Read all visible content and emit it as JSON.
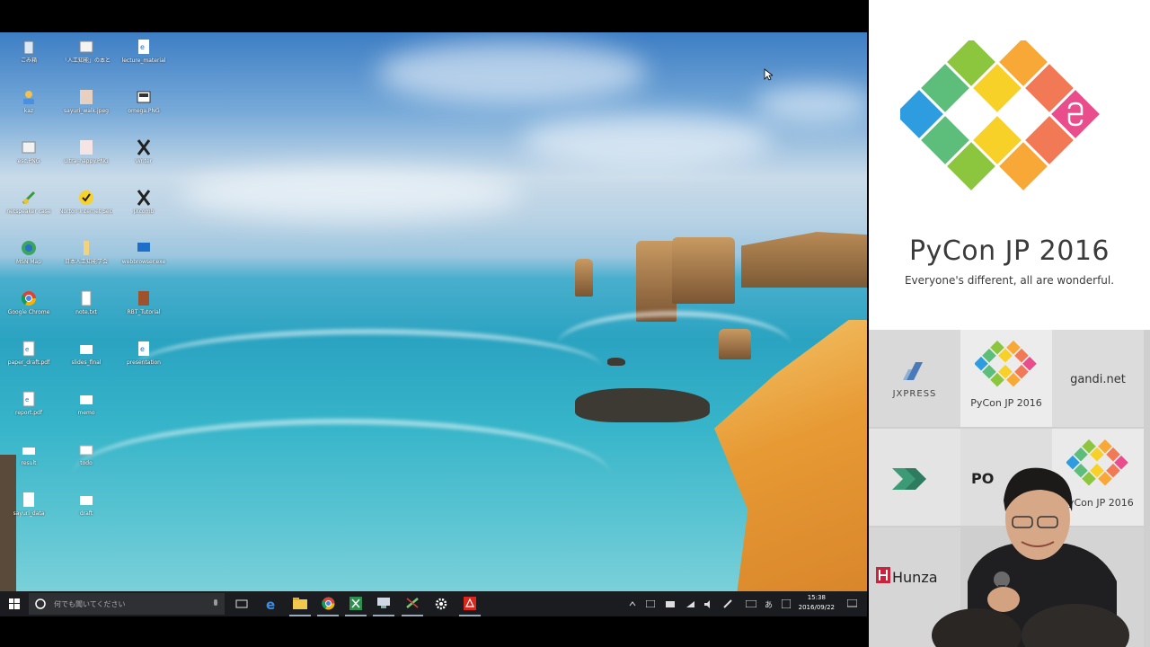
{
  "desktop": {
    "icons": [
      {
        "label": "ごみ箱",
        "icon": "recycle-bin-icon"
      },
      {
        "label": "「人工知能」の本と",
        "icon": "document-icon"
      },
      {
        "label": "lecture_material",
        "icon": "edge-pdf-icon"
      },
      {
        "label": "kaz",
        "icon": "user-folder-icon"
      },
      {
        "label": "sayuri_walk.jpeg",
        "icon": "photo-icon"
      },
      {
        "label": "omega.PNG",
        "icon": "image-icon"
      },
      {
        "label": "esc.PNG",
        "icon": "image-icon"
      },
      {
        "label": "ultra_happy.PNG",
        "icon": "photo-icon"
      },
      {
        "label": "Writer",
        "icon": "x-app-icon"
      },
      {
        "label": "netspeaker case",
        "icon": "app-icon"
      },
      {
        "label": "Norton Internet Security",
        "icon": "norton-icon"
      },
      {
        "label": "JXcomb",
        "icon": "x-app-icon"
      },
      {
        "label": "MSN Map",
        "icon": "globe-icon"
      },
      {
        "label": "日本人工知能学会",
        "icon": "folder-icon"
      },
      {
        "label": "webbrowser.exe",
        "icon": "monitor-icon"
      },
      {
        "label": "Google Chrome",
        "icon": "chrome-icon"
      },
      {
        "label": "note.txt",
        "icon": "text-file-icon"
      },
      {
        "label": "RBT_Tutorial",
        "icon": "book-icon"
      },
      {
        "label": "paper_draft.pdf",
        "icon": "pdf-icon"
      },
      {
        "label": "slides_final",
        "icon": "file-icon"
      },
      {
        "label": "presentation",
        "icon": "edge-pdf-icon"
      },
      {
        "label": "report.pdf",
        "icon": "pdf-icon"
      },
      {
        "label": "memo",
        "icon": "file-icon"
      },
      {
        "label": "result",
        "icon": "file-icon"
      },
      {
        "label": "todo",
        "icon": "image-icon"
      },
      {
        "label": "sayuri_data",
        "icon": "file-icon"
      },
      {
        "label": "draft",
        "icon": "file-icon"
      }
    ]
  },
  "taskbar": {
    "search_placeholder": "何でも聞いてください",
    "apps": [
      "task-view-icon",
      "edge-icon",
      "explorer-icon",
      "chrome-icon",
      "excel-icon",
      "network-icon",
      "tool-icon",
      "settings-icon",
      "acrobat-icon"
    ],
    "time": "15:38",
    "date": "2016/09/22"
  },
  "branding": {
    "title": "PyCon JP 2016",
    "tagline": "Everyone's different, all are wonderful.",
    "colors": [
      "#8cc63f",
      "#f7a836",
      "#5dbd7a",
      "#f7d028",
      "#f27956",
      "#2e9de0",
      "#e94d8c"
    ]
  },
  "sponsor_wall": {
    "jxpress": "JXPRESS",
    "pycon": "PyCon JP 2016",
    "gandi": "gandi.net",
    "hunza": "Hunza",
    "partial": "PO"
  }
}
